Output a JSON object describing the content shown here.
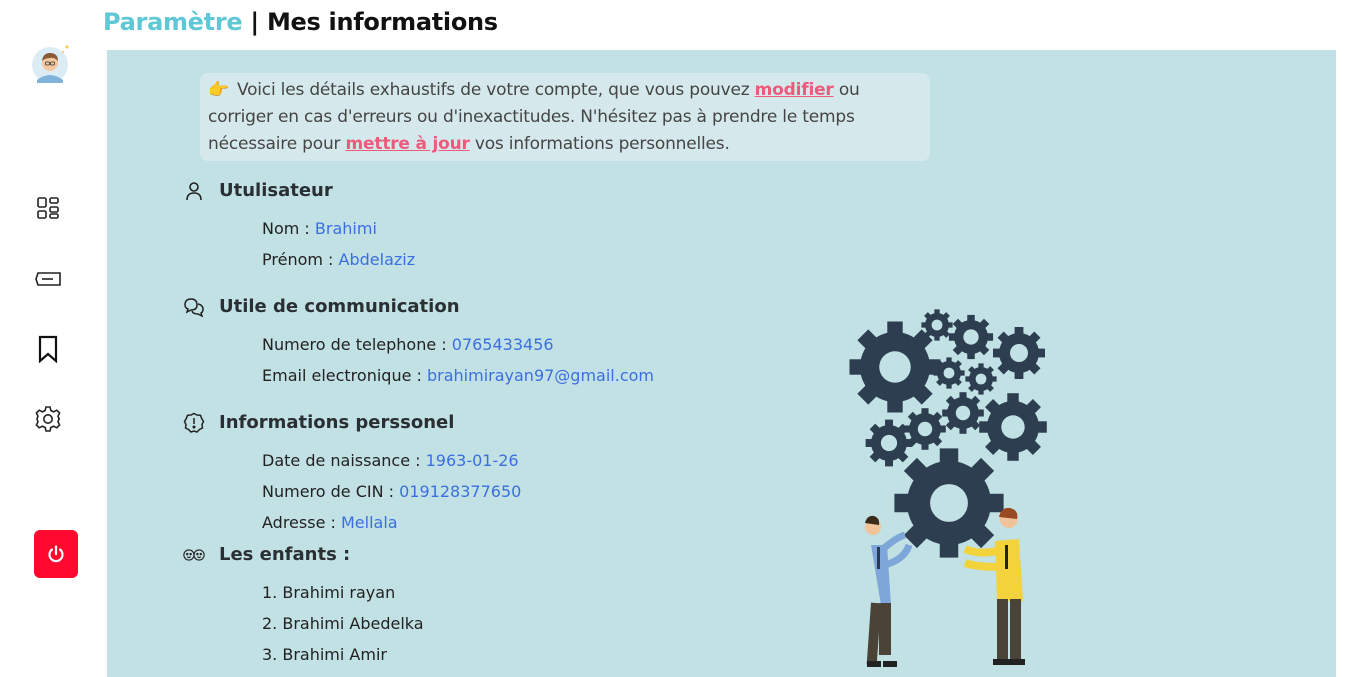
{
  "header": {
    "section": "Paramètre",
    "separator": "|",
    "title": "Mes informations"
  },
  "sidebar": {
    "items": [
      {
        "icon": "dashboard-icon"
      },
      {
        "icon": "ticket-icon"
      },
      {
        "icon": "bookmark-icon"
      },
      {
        "icon": "gear-icon"
      }
    ],
    "logout_icon": "power-icon",
    "logout_color": "#ff0a2e"
  },
  "notice": {
    "icon": "👉",
    "text_1": "Voici les détails exhaustifs de votre compte, que vous pouvez ",
    "link_1": "modifier",
    "text_2": " ou corriger en cas d'erreurs ou d'inexactitudes. N'hésitez pas à prendre le temps nécessaire pour ",
    "link_2": "mettre à jour",
    "text_3": " vos informations personnelles."
  },
  "user": {
    "title": "Utulisateur",
    "nom_label": "Nom : ",
    "nom": "Brahimi",
    "prenom_label": "Prénom : ",
    "prenom": "Abdelaziz"
  },
  "communication": {
    "title": "Utile de communication",
    "phone_label": "Numero de telephone : ",
    "phone": "0765433456",
    "email_label": "Email electronique : ",
    "email": "brahimirayan97@gmail.com"
  },
  "personal": {
    "title": "Informations perssonel",
    "birth_label": "Date de naissance : ",
    "birth": "1963-01-26",
    "cin_label": "Numero de CIN : ",
    "cin": "019128377650",
    "address_label": "Adresse : ",
    "address": "Mellala"
  },
  "children": {
    "title": "Les enfants :",
    "items": [
      "1. Brahimi rayan",
      "2. Brahimi Abedelka",
      "3. Brahimi Amir"
    ]
  },
  "colors": {
    "accent": "#5ec8d6",
    "panel": "#c2e1e4",
    "value": "#3b6fe0",
    "link": "#ee5a7c"
  }
}
